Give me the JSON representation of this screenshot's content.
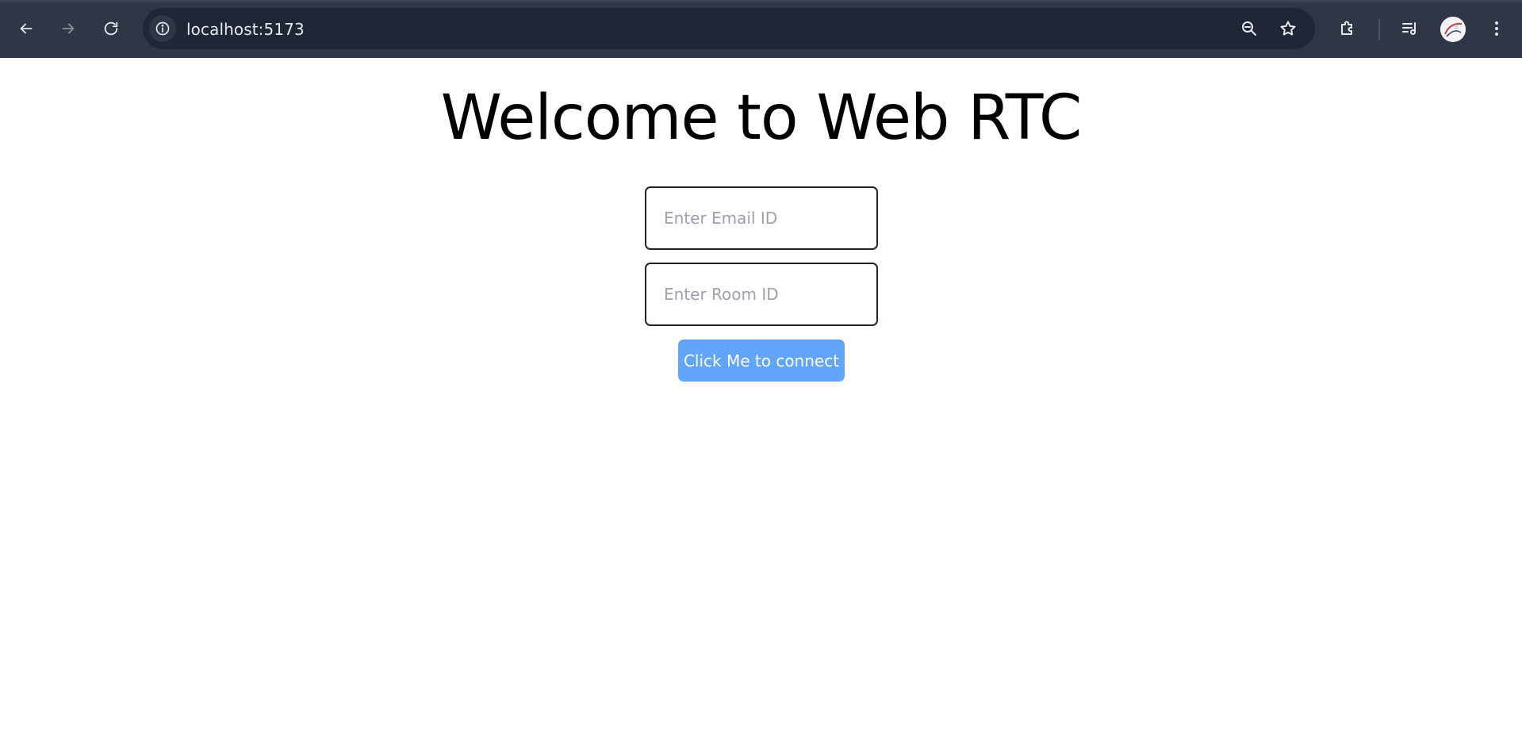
{
  "browser": {
    "url": "localhost:5173",
    "icons": {
      "back": "arrow-left-icon",
      "forward": "arrow-right-icon",
      "reload": "reload-icon",
      "site_info": "info-icon",
      "zoom": "zoom-out-icon",
      "bookmark": "star-icon",
      "extensions": "puzzle-icon",
      "media": "media-queue-icon",
      "menu": "kebab-menu-icon"
    },
    "colors": {
      "toolbar_bg": "#303646",
      "omnibox_bg": "#1f2636"
    }
  },
  "page": {
    "title": "Welcome to Web RTC",
    "email_placeholder": "Enter Email ID",
    "email_value": "",
    "room_placeholder": "Enter Room ID",
    "room_value": "",
    "connect_label": "Click Me to connect",
    "colors": {
      "button_bg": "#60a5fa",
      "input_border": "#1e2433"
    }
  }
}
